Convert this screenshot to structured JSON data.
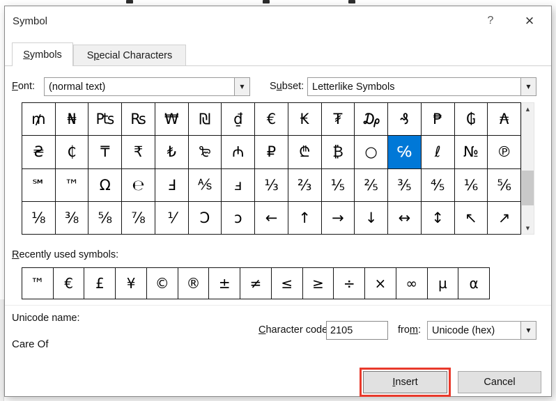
{
  "window": {
    "title": "Symbol"
  },
  "icons": {
    "help": "?",
    "close": "×",
    "dropdown": "▼",
    "scroll_up": "▲",
    "scroll_down": "▼"
  },
  "tabs": {
    "symbols": "&Symbols",
    "special": "S&pecial Characters"
  },
  "controls": {
    "font_label": "&Font:",
    "font_value": "(normal text)",
    "subset_label": "S&ubset:",
    "subset_value": "Letterlike Symbols"
  },
  "symbol_grid": {
    "rows": [
      [
        "₥",
        "₦",
        "₧",
        "₨",
        "₩",
        "₪",
        "₫",
        "€",
        "₭",
        "₮",
        "₯",
        "₰",
        "₱",
        "₲",
        "₳"
      ],
      [
        "₴",
        "₵",
        "₸",
        "₹",
        "₺",
        "₻",
        "₼",
        "₽",
        "₾",
        "₿",
        "○",
        "℅",
        "ℓ",
        "№",
        "℗"
      ],
      [
        "℠",
        "™",
        "Ω",
        "℮",
        "Ⅎ",
        "⅍",
        "ⅎ",
        "⅓",
        "⅔",
        "⅕",
        "⅖",
        "⅗",
        "⅘",
        "⅙",
        "⅚"
      ],
      [
        "⅛",
        "⅜",
        "⅝",
        "⅞",
        "⅟",
        "Ↄ",
        "ↄ",
        "←",
        "↑",
        "→",
        "↓",
        "↔",
        "↕",
        "↖",
        "↗"
      ]
    ],
    "selected": {
      "row": 1,
      "col": 11,
      "symbol": "℅"
    }
  },
  "recent": {
    "label": "&Recently used symbols:",
    "symbols": [
      "™",
      "€",
      "£",
      "¥",
      "©",
      "®",
      "±",
      "≠",
      "≤",
      "≥",
      "÷",
      "×",
      "∞",
      "µ",
      "α"
    ]
  },
  "details": {
    "unicode_name_label": "Unicode name:",
    "unicode_name_value": "Care Of",
    "char_code_label": "&Character code:",
    "char_code_value": "2105",
    "from_label": "fro&m:",
    "from_value": "Unicode (hex)"
  },
  "buttons": {
    "insert": "&Insert",
    "cancel": "Cancel"
  },
  "colors": {
    "selection_blue": "#0078d7",
    "annotation_red": "#e8392b"
  }
}
